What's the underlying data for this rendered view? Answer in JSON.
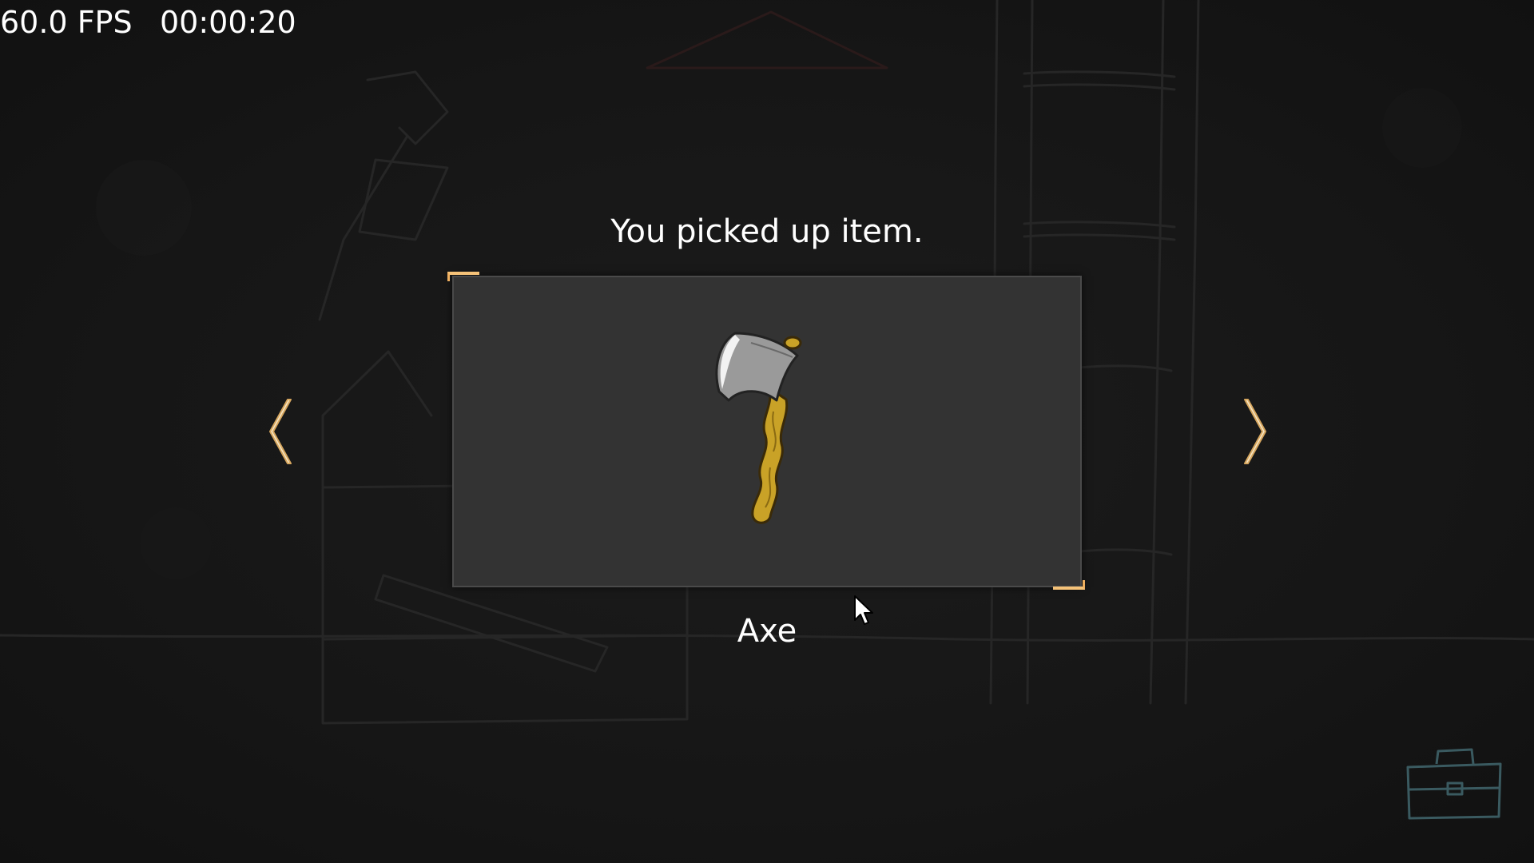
{
  "hud": {
    "fps": "60.0 FPS",
    "timer": "00:00:20"
  },
  "dialog": {
    "message": "You picked up item.",
    "item_name": "Axe",
    "item_icon": "axe-icon"
  },
  "navigation": {
    "prev_icon": "chevron-left-icon",
    "next_icon": "chevron-right-icon"
  },
  "inventory": {
    "icon": "briefcase-icon"
  },
  "colors": {
    "accent": "#f5c278",
    "panel": "#333333",
    "text": "#ffffff",
    "background": "#141414"
  }
}
